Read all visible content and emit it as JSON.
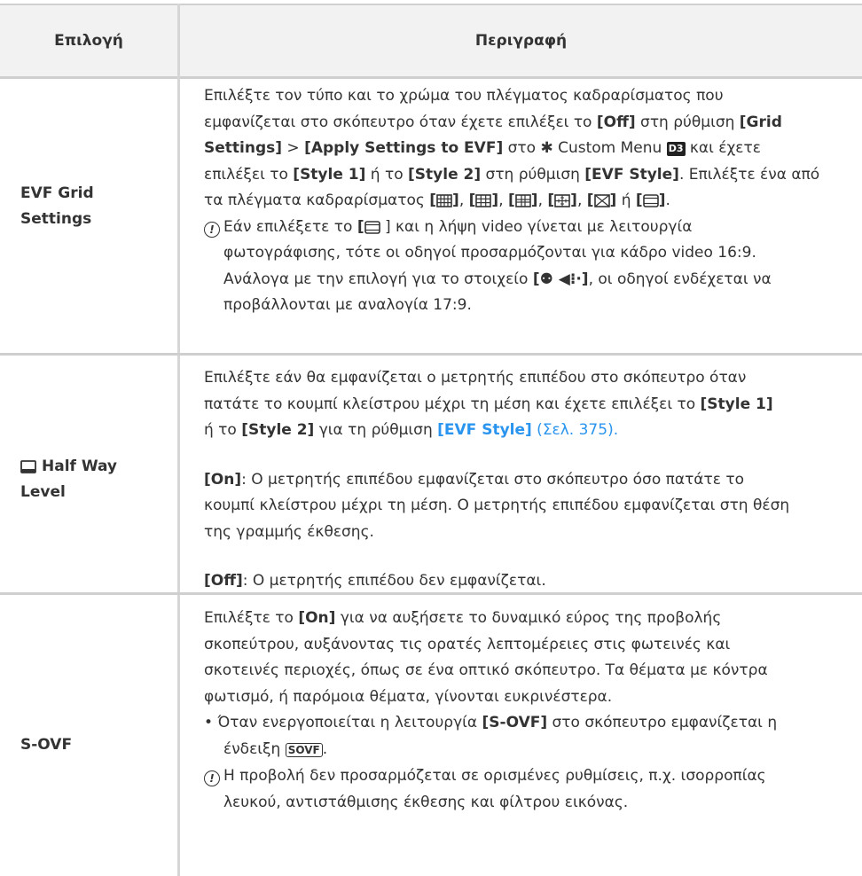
{
  "header": {
    "col_option": "Επιλογή",
    "col_description": "Περιγραφή"
  },
  "rows": [
    {
      "option": [
        "EVF Grid",
        "Settings"
      ],
      "p1_a": "Επιλέξτε τον τύπο και το χρώμα του πλέγματος καδραρίσματος που",
      "p1_b": "εμφανίζεται στο σκόπευτρο όταν έχετε επιλέξει το ",
      "off": "[Off]",
      "p1_c": " στη ρύθμιση ",
      "grid": "[Grid",
      "settings": "Settings]",
      "gt": " > ",
      "apply": "[Apply Settings to EVF]",
      "sto": " στο ",
      "custom_menu": " Custom Menu ",
      "d3": "D3",
      "p1_d": " και έχετε",
      "p1_e": "επιλέξει το ",
      "style1": "[Style 1]",
      "or_to": " ή το ",
      "style2": "[Style 2]",
      "p1_f": " στη ρύθμιση ",
      "evf_style": "[EVF Style]",
      "p1_g": ". Επιλέξτε ένα από",
      "p1_h": "τα πλέγματα καδραρίσματος ",
      "or": " ή ",
      "comma": ", ",
      "note1": "Εάν επιλέξετε το ",
      "note1_b": " ] και η λήψη video γίνεται με λειτουργία",
      "note2": "φωτογράφισης, τότε οι οδηγοί προσαρμόζονται για κάδρο video 16:9.",
      "note3": "Ανάλογα με την επιλογή για το στοιχείο ",
      "note3_b": ", οι οδηγοί ενδέχεται να",
      "note4": "προβάλλονται με αναλογία 17:9."
    },
    {
      "option": [
        "Half Way",
        "Level"
      ],
      "p1": "Επιλέξτε εάν θα εμφανίζεται ο μετρητής επιπέδου στο σκόπευτρο όταν",
      "p2": "πατάτε το κουμπί κλείστρου μέχρι τη μέση και έχετε επιλέξει το ",
      "style1": "[Style 1]",
      "p3_a": "ή το ",
      "style2": "[Style 2]",
      "p3_b": " για τη ρύθμιση ",
      "evf_style": "[EVF Style]",
      "page_ref": " (Σελ. 375).",
      "on": "[On]",
      "on_text_1": ": Ο μετρητής επιπέδου εμφανίζεται στο σκόπευτρο όσο πατάτε το",
      "on_text_2": "κουμπί κλείστρου μέχρι τη μέση. Ο μετρητής επιπέδου εμφανίζεται στη θέση",
      "on_text_3": "της γραμμής έκθεσης.",
      "off": "[Off]",
      "off_text": ": Ο μετρητής επιπέδου δεν εμφανίζεται."
    },
    {
      "option": [
        "S-OVF"
      ],
      "p1": "Επιλέξτε το ",
      "on": "[On]",
      "p1_b": " για να αυξήσετε το δυναμικό εύρος της προβολής",
      "p2": "σκοπεύτρου, αυξάνοντας τις ορατές λεπτομέρειες στις φωτεινές και",
      "p3": "σκοτεινές περιοχές, όπως σε ένα οπτικό σκόπευτρο. Τα θέματα με κόντρα",
      "p4": "φωτισμό, ή παρόμοια θέματα, γίνονται ευκρινέστερα.",
      "bullet_a": "Όταν ενεργοποιείται η λειτουργία ",
      "sovf": "[S-OVF]",
      "bullet_b": " στο σκόπευτρο εμφανίζεται η",
      "bullet_c": "ένδειξη ",
      "bullet_d": ".",
      "note1": "Η προβολή δεν προσαρμόζεται σε ορισμένες ρυθμίσεις, π.χ. ισορροπίας",
      "note2": "λευκού, αντιστάθμισης έκθεσης και φίλτρου εικόνας."
    }
  ]
}
